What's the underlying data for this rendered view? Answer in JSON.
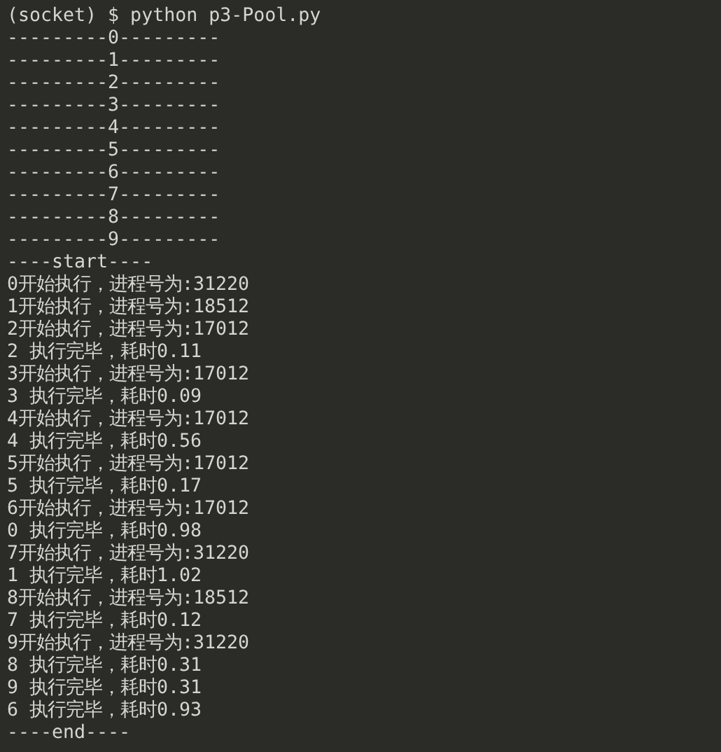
{
  "terminal": {
    "prompt": "(socket) $ python p3-Pool.py",
    "lines": [
      "---------0---------",
      "---------1---------",
      "---------2---------",
      "---------3---------",
      "---------4---------",
      "---------5---------",
      "---------6---------",
      "---------7---------",
      "---------8---------",
      "---------9---------",
      "----start----",
      "0开始执行，进程号为:31220",
      "1开始执行，进程号为:18512",
      "2开始执行，进程号为:17012",
      "2 执行完毕，耗时0.11",
      "3开始执行，进程号为:17012",
      "3 执行完毕，耗时0.09",
      "4开始执行，进程号为:17012",
      "4 执行完毕，耗时0.56",
      "5开始执行，进程号为:17012",
      "5 执行完毕，耗时0.17",
      "6开始执行，进程号为:17012",
      "0 执行完毕，耗时0.98",
      "7开始执行，进程号为:31220",
      "1 执行完毕，耗时1.02",
      "8开始执行，进程号为:18512",
      "7 执行完毕，耗时0.12",
      "9开始执行，进程号为:31220",
      "8 执行完毕，耗时0.31",
      "9 执行完毕，耗时0.31",
      "6 执行完毕，耗时0.93",
      "----end----"
    ]
  }
}
